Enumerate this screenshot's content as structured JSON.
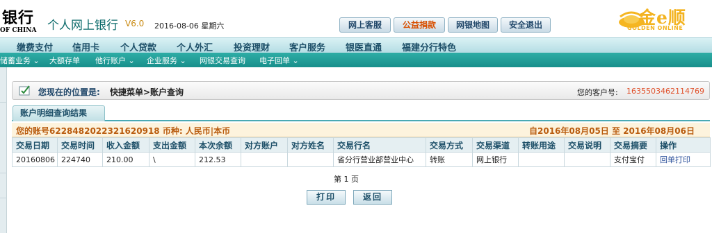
{
  "header": {
    "bank_name": "银行",
    "bank_name_en": "OF CHINA",
    "app_title": "个人网上银行",
    "version": "V6.0",
    "date": "2016-08-06 星期六",
    "buttons": [
      "网上客服",
      "公益捐款",
      "网银地图",
      "安全退出"
    ],
    "golden_logo_text": "金e顺",
    "golden_logo_sub": "GOLDEN ONLINE",
    "accent_orange": "#d84f00",
    "title_color": "#0d6b6b"
  },
  "main_nav": [
    "缴费支付",
    "信用卡",
    "个人贷款",
    "个人外汇",
    "投资理财",
    "客户服务",
    "银医直通",
    "福建分行特色"
  ],
  "sub_nav": [
    "储蓄业务 ⌄",
    "大额存单",
    "他行账户 ⌄",
    "企业服务 ⌄",
    "网银交易查询",
    "电子回单 ⌄"
  ],
  "location": {
    "label": "您现在的位置是:",
    "path": "快捷菜单>账户查询",
    "customer_label": "您的客户号:",
    "customer_no": "1635503462114769"
  },
  "result_tab": "账户明细查询结果",
  "account_bar": {
    "account": "您的账号6228482022321620918 币种: 人民币|本币",
    "date_range": "自2016年08月05日 至 2016年08月06日"
  },
  "table": {
    "headers": [
      "交易日期",
      "交易时间",
      "收入金额",
      "支出金额",
      "本次余额",
      "对方账户",
      "对方姓名",
      "交易行名",
      "交易方式",
      "交易渠道",
      "转账用途",
      "交易说明",
      "交易摘要",
      "操作"
    ],
    "rows": [
      [
        "20160806",
        "224740",
        "210.00",
        "\\",
        "212.53",
        "",
        "",
        "省分行营业部营业中心",
        "转账",
        "网上银行",
        "",
        "",
        "支付宝付",
        "回单打印"
      ]
    ]
  },
  "page_info": "第 1 页",
  "footer_buttons": [
    "打印",
    "返回"
  ]
}
